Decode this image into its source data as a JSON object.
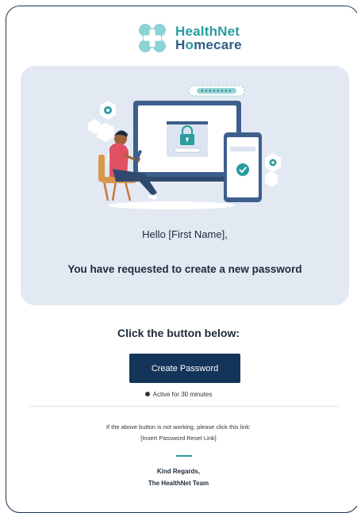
{
  "brand": {
    "line1": "HealthNet",
    "line2_pre": "H",
    "line2_o": "o",
    "line2_post": "mecare",
    "teal": "#2a9d9f",
    "navy": "#2f5d86"
  },
  "hero": {
    "greeting": "Hello [First Name],",
    "message": "You have requested to create a new password",
    "background": "#e2e9f3"
  },
  "cta": {
    "heading": "Click the button below:",
    "button_label": "Create Password",
    "button_color": "#14355a",
    "active_text": "Active for 30 minutes"
  },
  "fallback": {
    "text": "If the above button is not working, please click this link:",
    "link_text": "[Insert Password Reset Link]"
  },
  "signature": {
    "line1": "Kind Regards,",
    "line2": "The HealthNet Team"
  }
}
